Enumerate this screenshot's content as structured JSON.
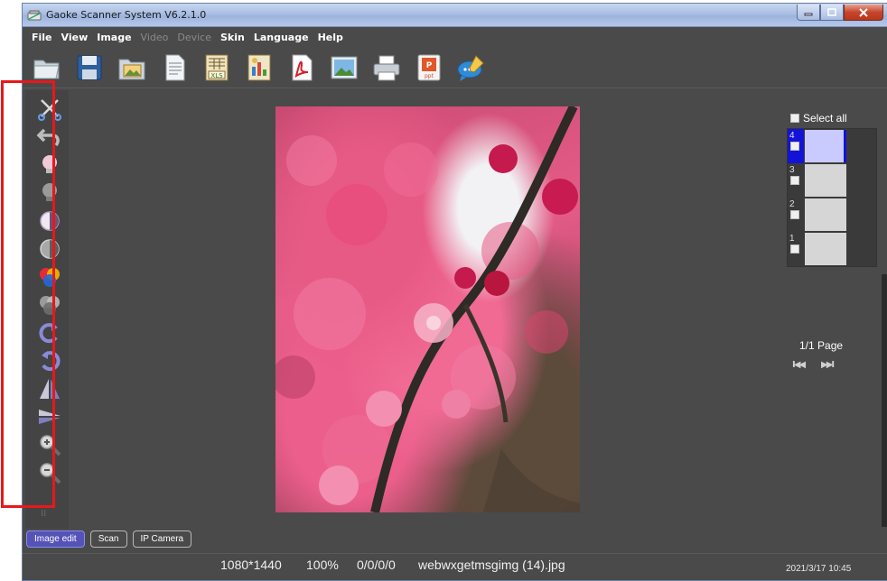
{
  "window": {
    "title": "Gaoke Scanner System V6.2.1.0"
  },
  "menubar": {
    "items": [
      {
        "label": "File",
        "enabled": true
      },
      {
        "label": "View",
        "enabled": true
      },
      {
        "label": "Image",
        "enabled": true
      },
      {
        "label": "Video",
        "enabled": false
      },
      {
        "label": "Device",
        "enabled": false
      },
      {
        "label": "Skin",
        "enabled": true
      },
      {
        "label": "Language",
        "enabled": true
      },
      {
        "label": "Help",
        "enabled": true
      }
    ]
  },
  "toolbar": {
    "buttons": [
      {
        "icon": "open-folder-icon"
      },
      {
        "icon": "save-icon"
      },
      {
        "icon": "image-folder-icon"
      },
      {
        "icon": "document-icon"
      },
      {
        "icon": "excel-icon",
        "label": "XLS"
      },
      {
        "icon": "chart-document-icon"
      },
      {
        "icon": "pdf-icon"
      },
      {
        "icon": "picture-icon"
      },
      {
        "icon": "print-icon"
      },
      {
        "icon": "ppt-icon",
        "label": "ppt"
      },
      {
        "icon": "chat-edit-icon"
      }
    ]
  },
  "left_tools": [
    {
      "icon": "crop-icon"
    },
    {
      "icon": "undo-icon"
    },
    {
      "icon": "brightness-up-icon"
    },
    {
      "icon": "brightness-down-icon"
    },
    {
      "icon": "contrast-up-icon"
    },
    {
      "icon": "contrast-down-icon"
    },
    {
      "icon": "color-saturation-up-icon"
    },
    {
      "icon": "color-saturation-down-icon"
    },
    {
      "icon": "rotate-right-icon"
    },
    {
      "icon": "rotate-left-icon"
    },
    {
      "icon": "flip-horizontal-icon"
    },
    {
      "icon": "flip-vertical-icon"
    },
    {
      "icon": "zoom-in-icon"
    },
    {
      "icon": "zoom-out-icon"
    }
  ],
  "right_panel": {
    "select_all_label": "Select all",
    "thumbnails": [
      {
        "number": "4",
        "selected": true
      },
      {
        "number": "3",
        "selected": false
      },
      {
        "number": "2",
        "selected": false
      },
      {
        "number": "1",
        "selected": false
      }
    ],
    "page_indicator": "1/1 Page",
    "nav_first": "I◀◀",
    "nav_last": "▶▶I"
  },
  "bottom_tabs": [
    {
      "label": "Image edit",
      "active": true
    },
    {
      "label": "Scan",
      "active": false
    },
    {
      "label": "IP Camera",
      "active": false
    }
  ],
  "status": {
    "resolution": "1080*1440",
    "zoom": "100%",
    "coords": "0/0/0/0",
    "filename": "webwxgetmsgimg (14).jpg",
    "timestamp": "2021/3/17 10:45"
  },
  "colors": {
    "highlight_box": "#e8181b",
    "selected_thumb": "#1313d8",
    "active_tab": "#5552b8"
  }
}
